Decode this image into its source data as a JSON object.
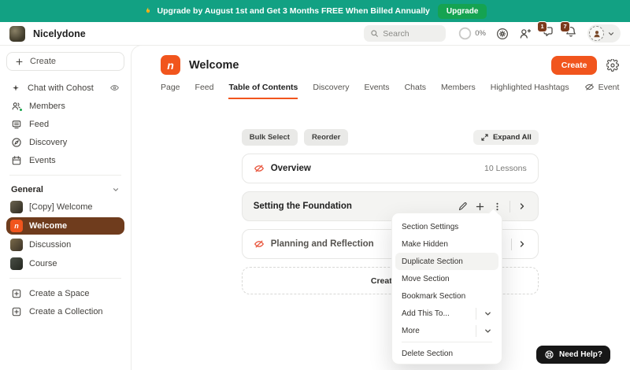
{
  "colors": {
    "banner_green": "#12A183",
    "upgrade_button_green": "#15A351",
    "accent_orange": "#F1551D",
    "active_space_brown": "#6F3C1D",
    "badge_brown": "#7B3A1C",
    "hidden_eye_orange": "#E8553C",
    "menu_highlight_gray": "#F3F3F1"
  },
  "banner": {
    "icon": "flame-icon",
    "message": "Upgrade by August 1st and Get 3 Months FREE When Billed Annually",
    "button_label": "Upgrade"
  },
  "topbar": {
    "workspace_name": "Nicelydone",
    "search_placeholder": "Search",
    "progress_label": "0%",
    "messages_badge": "1",
    "notifications_badge": "7",
    "icons": [
      "progress-circle",
      "gear-circle-icon",
      "invite-member-icon",
      "messages-icon",
      "notifications-icon",
      "avatar",
      "chevron-down-icon"
    ]
  },
  "sidebar": {
    "create_button_label": "Create",
    "items": [
      {
        "label": "Chat with Cohost",
        "icon": "cohost-sparkle-icon",
        "trailing_icon": "eye-icon"
      },
      {
        "label": "Members",
        "icon": "members-icon"
      },
      {
        "label": "Feed",
        "icon": "feed-icon"
      },
      {
        "label": "Discovery",
        "icon": "discovery-compass-icon"
      },
      {
        "label": "Events",
        "icon": "events-calendar-icon"
      }
    ],
    "group_label": "General",
    "spaces": [
      {
        "label": "[Copy] Welcome"
      },
      {
        "label": "Welcome",
        "active": true
      },
      {
        "label": "Discussion"
      },
      {
        "label": "Course"
      }
    ],
    "footer_items": [
      {
        "label": "Create a Space",
        "icon": "plus-square-icon"
      },
      {
        "label": "Create a Collection",
        "icon": "plus-square-icon"
      }
    ]
  },
  "main": {
    "space_title": "Welcome",
    "create_button_label": "Create",
    "tabs": [
      {
        "label": "Page"
      },
      {
        "label": "Feed"
      },
      {
        "label": "Table of Contents",
        "active": true
      },
      {
        "label": "Discovery"
      },
      {
        "label": "Events"
      },
      {
        "label": "Chats"
      },
      {
        "label": "Members"
      },
      {
        "label": "Highlighted Hashtags"
      },
      {
        "label": "Event",
        "icon": "eye-slash-icon"
      }
    ],
    "toolbar": {
      "bulk_select_label": "Bulk Select",
      "reorder_label": "Reorder",
      "expand_all_label": "Expand All"
    },
    "sections": [
      {
        "title": "Overview",
        "hidden": true,
        "meta": "10 Lessons"
      },
      {
        "title": "Setting the Foundation",
        "hovered": true
      },
      {
        "title": "Planning and Reflection",
        "hidden": true
      }
    ],
    "create_section_label": "Create"
  },
  "context_menu": {
    "items": [
      {
        "label": "Section Settings"
      },
      {
        "label": "Make Hidden"
      },
      {
        "label": "Duplicate Section",
        "highlighted": true
      },
      {
        "label": "Move Section"
      },
      {
        "label": "Bookmark Section"
      },
      {
        "label": "Add This To...",
        "submenu": true
      },
      {
        "label": "More",
        "submenu": true
      },
      {
        "label": "Delete Section",
        "divider_above": true
      }
    ]
  },
  "help_button": {
    "label": "Need Help?",
    "icon": "lifebuoy-icon"
  }
}
